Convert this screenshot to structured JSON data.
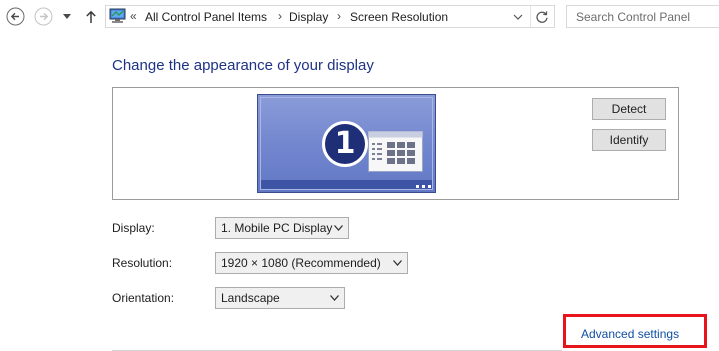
{
  "nav": {
    "back_icon": "back-arrow-icon",
    "forward_icon": "forward-arrow-icon",
    "recent_icon": "chevron-down-icon",
    "up_icon": "up-arrow-icon"
  },
  "address_bar": {
    "icon": "control-panel-icon",
    "overflow": "«",
    "breadcrumbs": [
      "All Control Panel Items",
      "Display",
      "Screen Resolution"
    ],
    "separator": "›"
  },
  "search": {
    "placeholder": "Search Control Panel"
  },
  "content": {
    "title": "Change the appearance of your display",
    "monitor": {
      "number": "1"
    },
    "buttons": {
      "detect": "Detect",
      "identify": "Identify"
    },
    "fields": {
      "display": {
        "label": "Display:",
        "value": "1. Mobile PC Display"
      },
      "resolution": {
        "label": "Resolution:",
        "value": "1920 × 1080 (Recommended)"
      },
      "orientation": {
        "label": "Orientation:",
        "value": "Landscape"
      }
    },
    "advanced_link": "Advanced settings"
  },
  "colors": {
    "title": "#1e3287",
    "link": "#0f4fa3",
    "highlight": "#e8141c",
    "monitor": "#7387cf"
  }
}
